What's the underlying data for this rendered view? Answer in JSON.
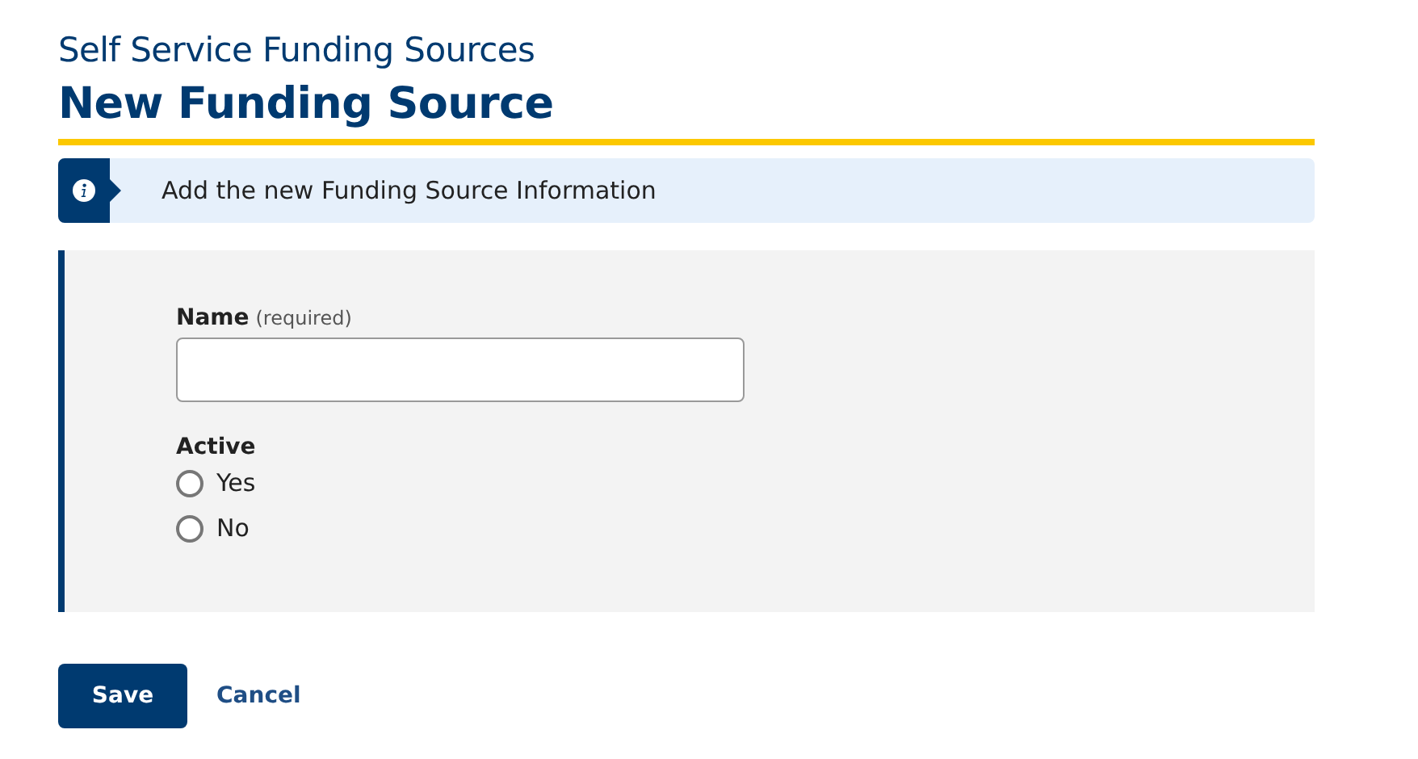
{
  "page": {
    "subtitle": "Self Service Funding Sources",
    "title": "New Funding Source"
  },
  "info": {
    "text": "Add the new Funding Source Information"
  },
  "form": {
    "name_field": {
      "label": "Name",
      "hint": "(required)"
    },
    "active": {
      "label": "Active",
      "options": [
        {
          "label": "Yes",
          "selected": false
        },
        {
          "label": "No",
          "selected": false
        }
      ]
    }
  },
  "buttons": {
    "save": "Save",
    "cancel": "Cancel"
  }
}
